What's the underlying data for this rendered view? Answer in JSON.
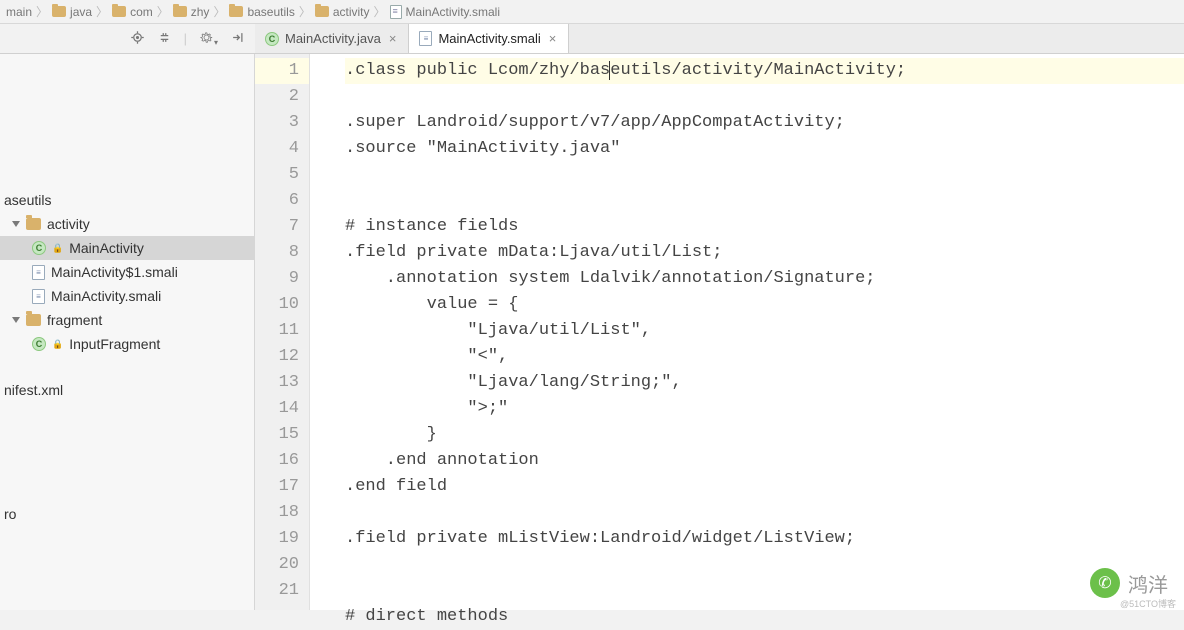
{
  "breadcrumb": {
    "c0": "main",
    "c1": "java",
    "c2": "com",
    "c3": "zhy",
    "c4": "baseutils",
    "c5": "activity",
    "c6": "MainActivity.smali"
  },
  "tabs": {
    "t0": {
      "label": "MainActivity.java"
    },
    "t1": {
      "label": "MainActivity.smali"
    }
  },
  "tree": {
    "n0": "aseutils",
    "n1": "activity",
    "n2": "MainActivity",
    "n3": "MainActivity$1.smali",
    "n4": "MainActivity.smali",
    "n5": "fragment",
    "n6": "InputFragment",
    "n7": "nifest.xml",
    "n8": "ro"
  },
  "gutter": {
    "l1": "1",
    "l2": "2",
    "l3": "3",
    "l4": "4",
    "l5": "5",
    "l6": "6",
    "l7": "7",
    "l8": "8",
    "l9": "9",
    "l10": "10",
    "l11": "11",
    "l12": "12",
    "l13": "13",
    "l14": "14",
    "l15": "15",
    "l16": "16",
    "l17": "17",
    "l18": "18",
    "l19": "19",
    "l20": "20",
    "l21": "21"
  },
  "code": {
    "l1a": ".class public Lcom/zhy/bas",
    "l1b": "eutils/activity/MainActivity;",
    "l2": ".super Landroid/support/v7/app/AppCompatActivity;",
    "l3": ".source \"MainActivity.java\"",
    "l4": "",
    "l5": "",
    "l6": "# instance fields",
    "l7": ".field private mData:Ljava/util/List;",
    "l8": "    .annotation system Ldalvik/annotation/Signature;",
    "l9": "        value = {",
    "l10": "            \"Ljava/util/List\",",
    "l11": "            \"<\",",
    "l12": "            \"Ljava/lang/String;\",",
    "l13": "            \">;\"",
    "l14": "        }",
    "l15": "    .end annotation",
    "l16": ".end field",
    "l17": "",
    "l18": ".field private mListView:Landroid/widget/ListView;",
    "l19": "",
    "l20": "",
    "l21": "# direct methods"
  },
  "watermark": {
    "text": "鸿洋",
    "small": "@51CTO博客"
  }
}
